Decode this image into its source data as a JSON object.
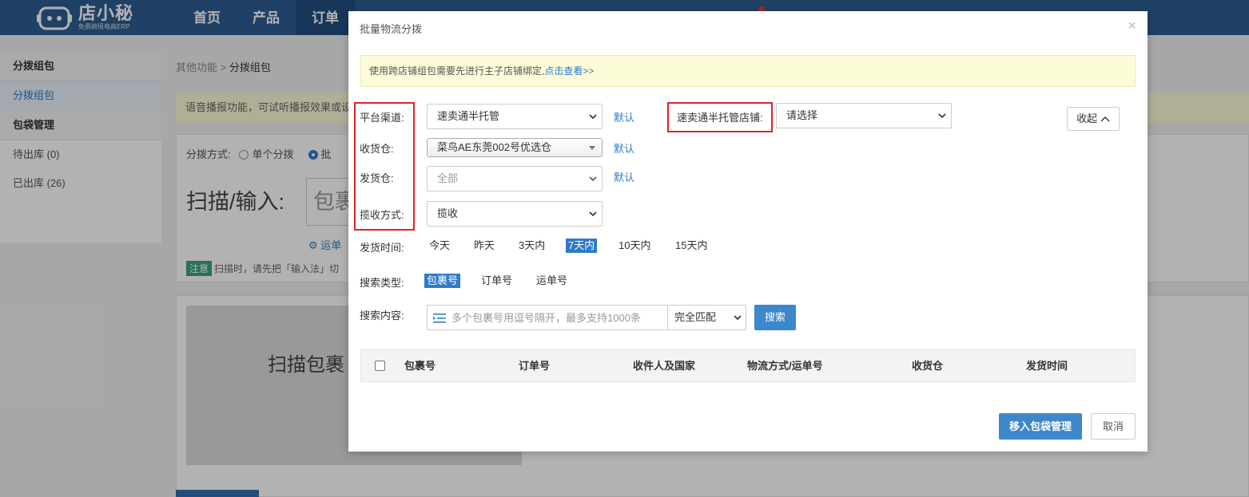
{
  "app": {
    "logo_title": "店小秘",
    "logo_sub": "免费跨境电商ERP",
    "nav": [
      {
        "label": "首页"
      },
      {
        "label": "产品"
      },
      {
        "label": "订单"
      }
    ],
    "accent": "#2e5d93"
  },
  "background": {
    "sidebar": [
      {
        "type": "group",
        "label": "分拨组包"
      },
      {
        "type": "item",
        "label": "分拨组包",
        "active": true
      },
      {
        "type": "group",
        "label": "包袋管理"
      },
      {
        "type": "item",
        "label": "待出库 (0)"
      },
      {
        "type": "item",
        "label": "已出库 (26)"
      }
    ],
    "breadcrumb_parent": "其他功能",
    "breadcrumb_sep": " > ",
    "breadcrumb_current": "分拨组包",
    "notice": "语音播报功能，可试听播报效果或设",
    "mode_label": "分拨方式:",
    "mode_single": "单个分拨",
    "mode_batch": "批",
    "scan_label": "扫描/输入:",
    "scan_placeholder": "包裹",
    "gear_text": "运单",
    "tip_tag": "注意",
    "tip_text": "扫描时，请先把「输入法」切",
    "scan_big": "扫描包裹"
  },
  "modal": {
    "title": "批量物流分拨",
    "notice_text": "使用跨店铺组包需要先进行主子店铺绑定,",
    "notice_link": "点击查看>>",
    "platform_label": "平台渠道:",
    "platform_value": "速卖通半托管",
    "warehouse_in_label": "收货仓:",
    "warehouse_in_value": "菜鸟AE东莞002号优选仓",
    "warehouse_out_label": "发货仓:",
    "warehouse_out_value": "全部",
    "pickup_label": "揽收方式:",
    "pickup_value": "揽收",
    "default_link": "默认",
    "store_label": "速卖通半托管店铺:",
    "store_value": "请选择",
    "collapse_label": "收起",
    "ship_time_label": "发货时间:",
    "ship_time_options": [
      {
        "label": "今天"
      },
      {
        "label": "昨天"
      },
      {
        "label": "3天内"
      },
      {
        "label": "7天内",
        "selected": true
      },
      {
        "label": "10天内"
      },
      {
        "label": "15天内"
      }
    ],
    "search_type_label": "搜索类型:",
    "search_type_options": [
      {
        "label": "包裹号",
        "selected": true
      },
      {
        "label": "订单号"
      },
      {
        "label": "运单号"
      }
    ],
    "search_content_label": "搜索内容:",
    "search_placeholder": "多个包裹号用逗号隔开，最多支持1000条",
    "match_value": "完全匹配",
    "search_button": "搜索",
    "table_columns": [
      "包裹号",
      "订单号",
      "收件人及国家",
      "物流方式/运单号",
      "收货仓",
      "发货时间"
    ],
    "primary_button": "移入包袋管理",
    "cancel_button": "取消",
    "highlight_color": "#e0232a",
    "button_color": "#3d87cc"
  }
}
